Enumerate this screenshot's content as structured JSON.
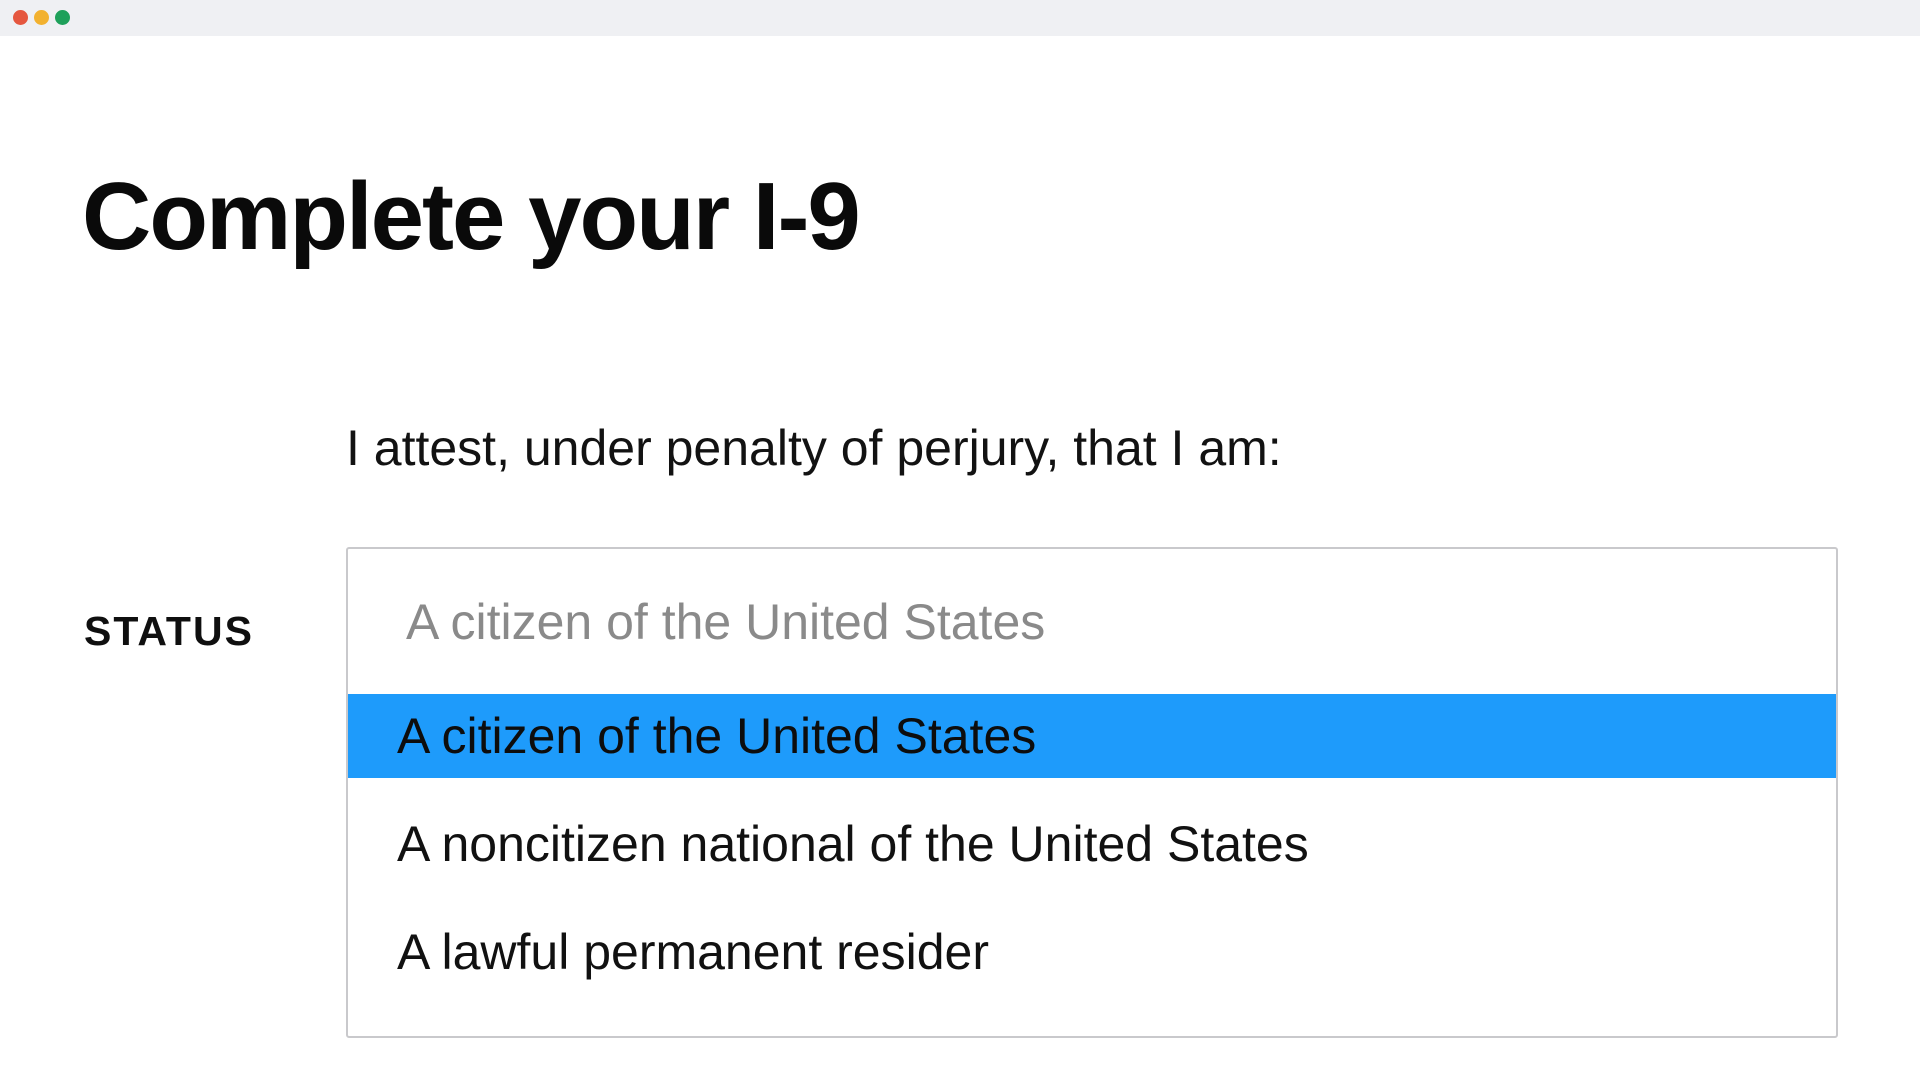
{
  "window": {
    "controls": [
      "close",
      "minimize",
      "maximize"
    ]
  },
  "page": {
    "title": "Complete your I-9",
    "attestation": "I attest, under penalty of perjury, that I am:"
  },
  "status_field": {
    "label": "STATUS",
    "selected_value": "A citizen of the United States",
    "options": [
      "A citizen of the United States",
      "A noncitizen national of the United States",
      "A lawful permanent resider"
    ],
    "highlighted_index": 0
  },
  "colors": {
    "highlight": "#1e9bfb",
    "titlebar": "#eff0f3",
    "close": "#e5573f",
    "minimize": "#f2b12f",
    "maximize": "#1ea05a"
  }
}
